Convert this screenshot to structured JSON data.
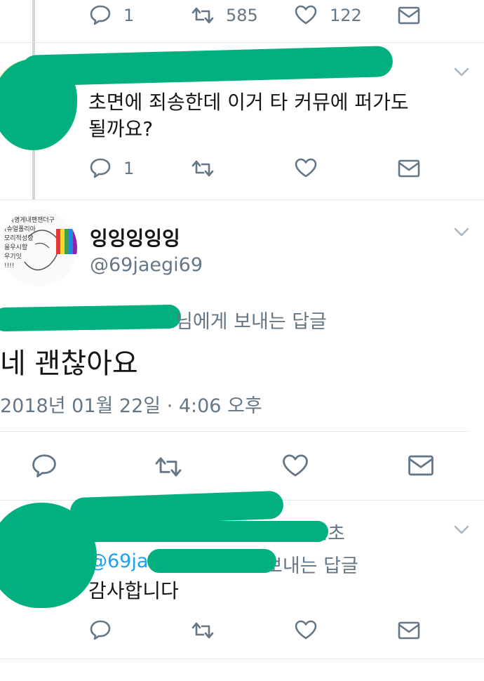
{
  "colors": {
    "accent": "#1da1f2",
    "text": "#14171a",
    "muted": "#657786",
    "divider": "#e1e8ed",
    "redaction": "#02b07f"
  },
  "top_actions": {
    "reply_count": "1",
    "retweet_count": "585",
    "like_count": "122"
  },
  "reply1": {
    "text_line1": "초면에 죄송한데 이거 타 커뮤에 퍼가도",
    "text_line2": "될까요?",
    "reply_count": "1"
  },
  "main_tweet": {
    "display_name": "잉잉잉잉잉",
    "handle": "@69jaegi69",
    "avatar_text": [
      "..덕명게내팬잰더구",
      "(슈얼폴리아",
      "모리적성향",
      "을우시할",
      "우기잇",
      "!!!!"
    ],
    "reply_to_suffix": "님에게 보내는 답글",
    "text": "네 괜찮아요",
    "timestamp": "2018년 01월 22일 · 4:06 오후"
  },
  "reply2": {
    "time": "2초",
    "reply_to_handle": "@69jaegi",
    "reply_to_suffix": "보내는 답글",
    "text": "감사합니다"
  },
  "icons": [
    "reply-icon",
    "retweet-icon",
    "like-icon",
    "message-icon",
    "chevron-down-icon"
  ]
}
